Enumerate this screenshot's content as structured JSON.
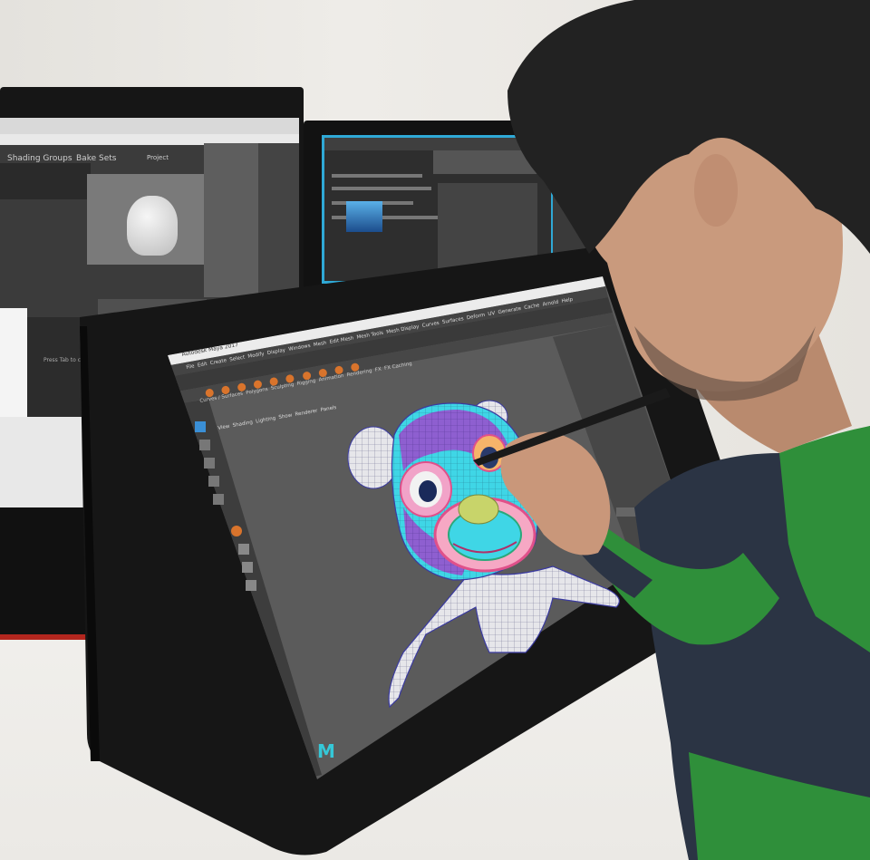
{
  "scene": {
    "description_tags": [
      "artist",
      "pen-display",
      "3d-modeling"
    ]
  },
  "maya": {
    "title": "Autodesk Maya 2017",
    "menus": [
      "File",
      "Edit",
      "Create",
      "Select",
      "Modify",
      "Display",
      "Windows",
      "Mesh",
      "Edit Mesh",
      "Mesh Tools",
      "Mesh Display",
      "Curves",
      "Surfaces",
      "Deform",
      "UV",
      "Generate",
      "Cache",
      "Arnold",
      "Help"
    ],
    "shelf_tabs": [
      "Curves / Surfaces",
      "Polygons",
      "Sculpting",
      "Rigging",
      "Animation",
      "Rendering",
      "FX",
      "FX Caching"
    ],
    "viewport_menus": [
      "View",
      "Shading",
      "Lighting",
      "Show",
      "Renderer",
      "Panels"
    ],
    "logo": "M"
  },
  "left_monitor": {
    "labels": [
      "Shading Groups",
      "Bake Sets",
      "Project",
      "Press Tab to create..."
    ]
  },
  "colors": {
    "maya_accent": "#35c8d8",
    "monitor_border": "#2fa9d6",
    "stand_red": "#b3261e",
    "sweater_green": "#2f8f3a",
    "sweater_navy": "#2b3444"
  }
}
